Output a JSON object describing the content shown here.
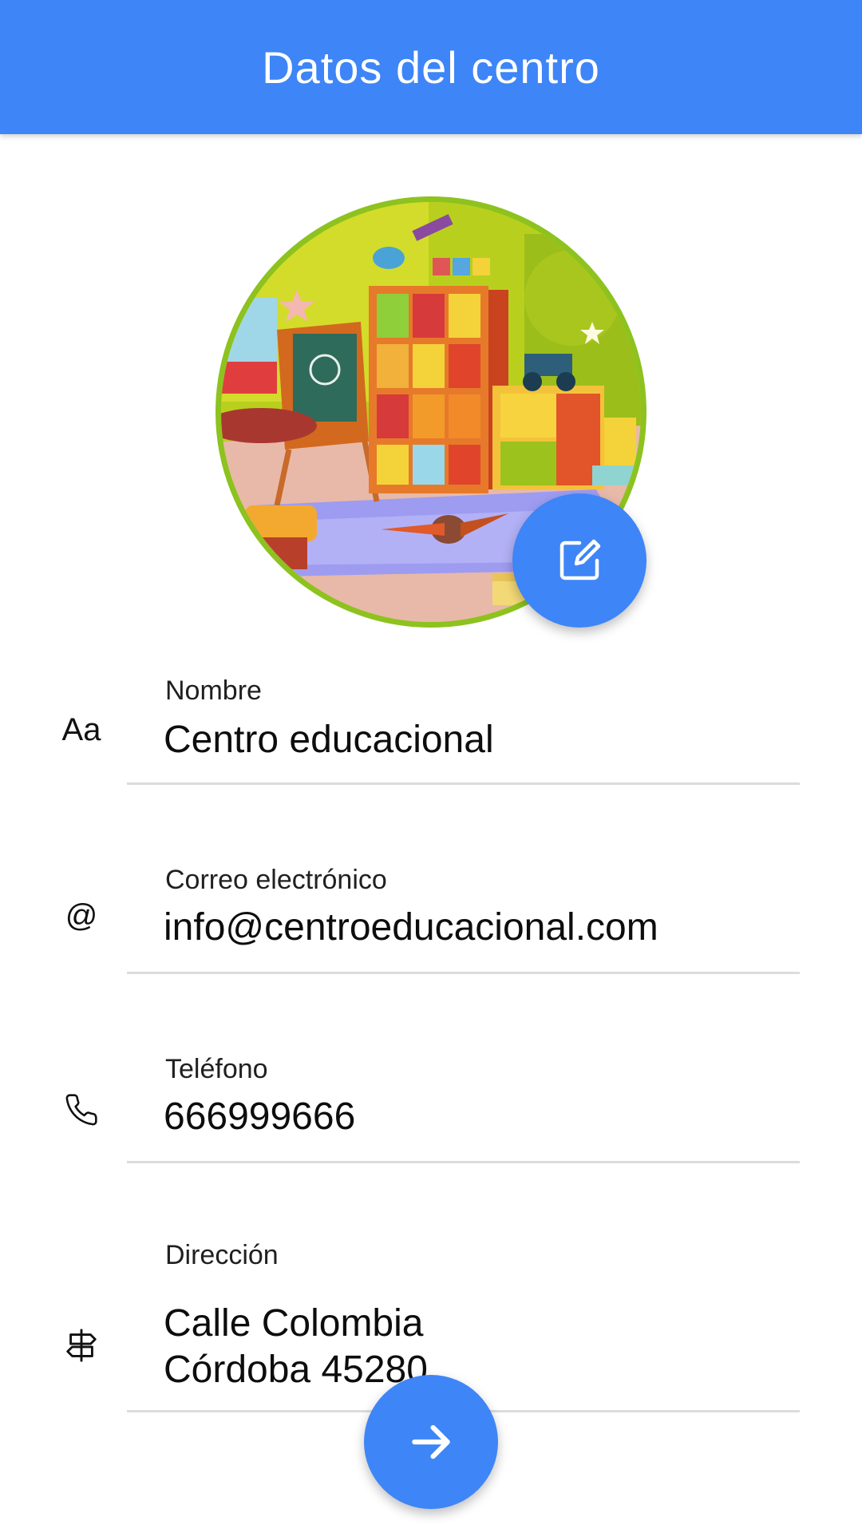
{
  "appbar": {
    "title": "Datos del centro",
    "color": "#3e85f7"
  },
  "avatar": {
    "border_color": "#8dc21f",
    "edit_icon": "edit-icon"
  },
  "fields": {
    "name": {
      "icon": "text-format-icon",
      "icon_text": "Aa",
      "label": "Nombre",
      "value": "Centro educacional"
    },
    "email": {
      "icon": "at-icon",
      "icon_text": "@",
      "label": "Correo electrónico",
      "value": "info@centroeducacional.com"
    },
    "phone": {
      "icon": "phone-icon",
      "label": "Teléfono",
      "value": "666999666"
    },
    "address": {
      "icon": "signpost-icon",
      "label": "Dirección",
      "value": "Calle Colombia\nCórdoba 45280"
    }
  },
  "next_button": {
    "icon": "arrow-right-icon"
  }
}
